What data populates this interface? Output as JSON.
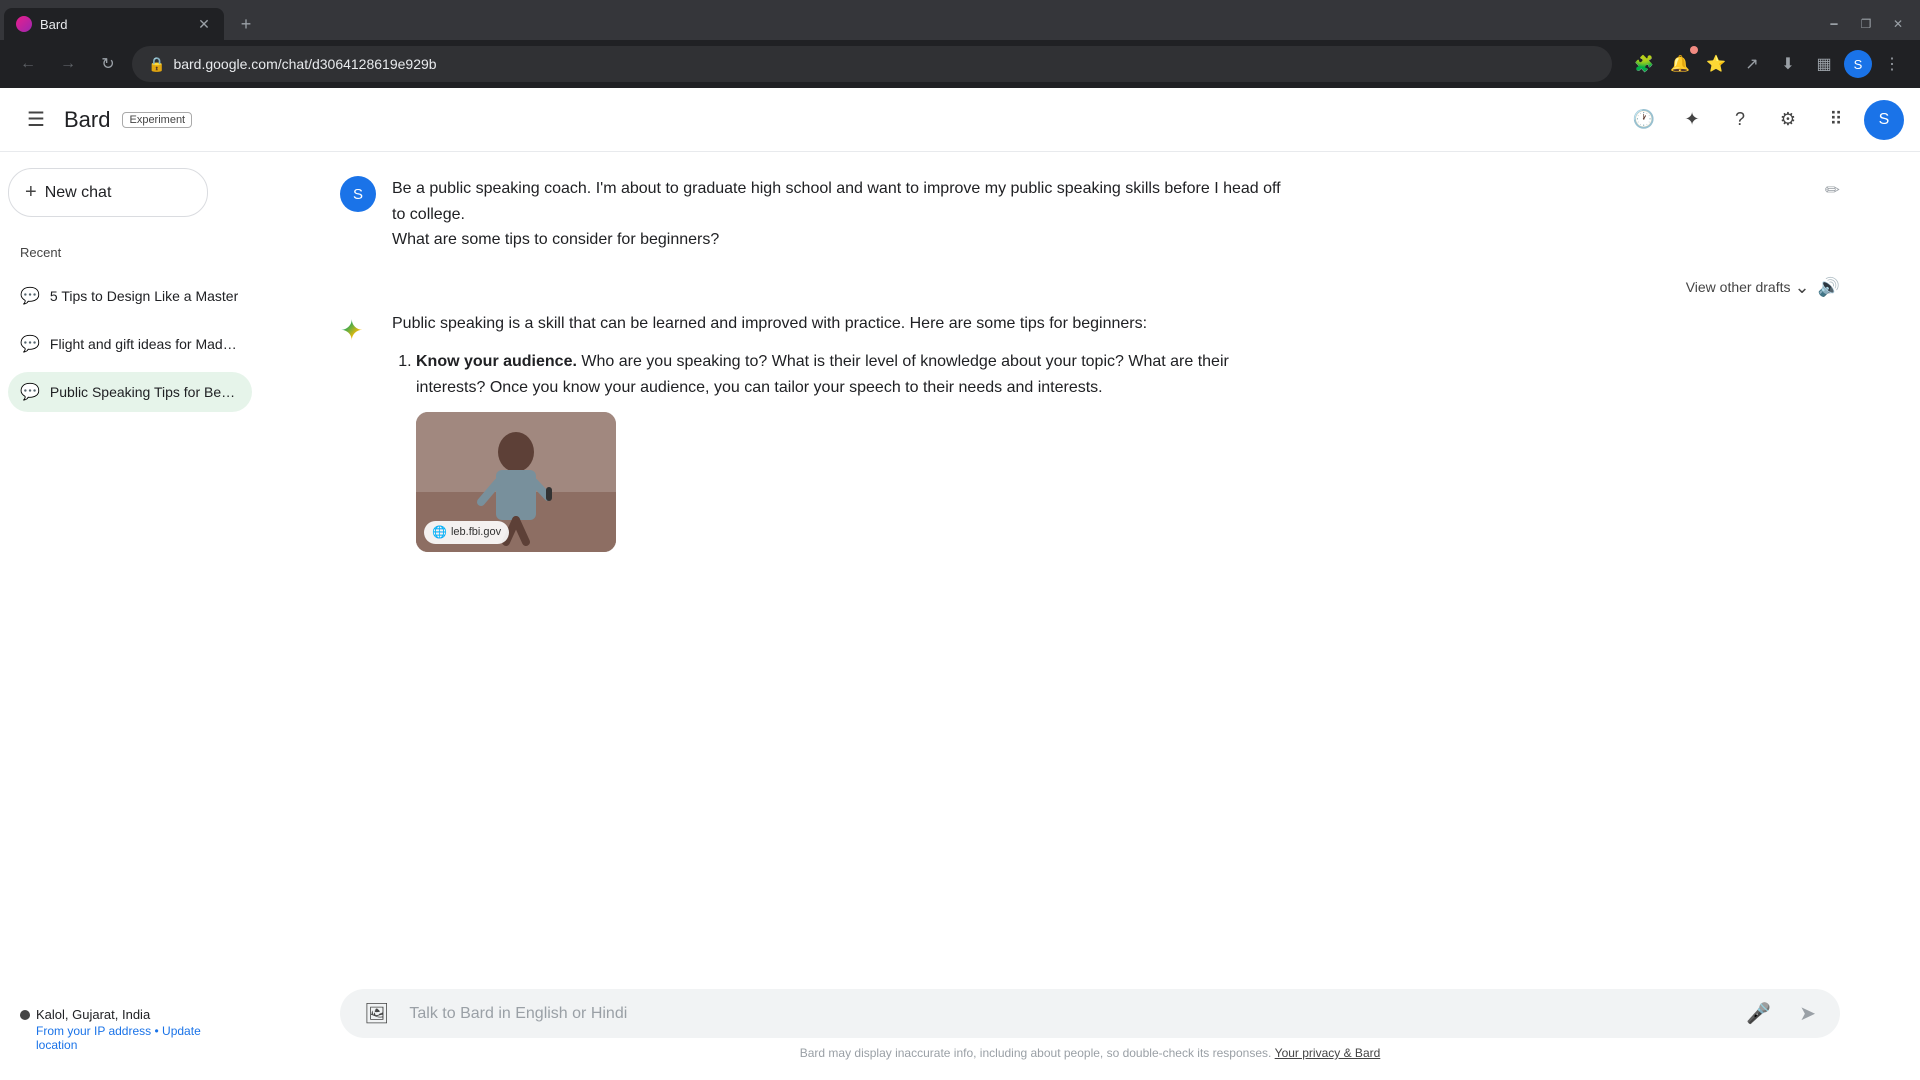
{
  "browser": {
    "tab_title": "Bard",
    "tab_favicon": "B",
    "address": "bard.google.com/chat/d3064128619e929b",
    "close_btn": "✕",
    "new_tab_btn": "+",
    "window_minimize": "—",
    "window_restore": "⧉",
    "window_close": "✕",
    "nav_back": "←",
    "nav_forward": "→",
    "nav_refresh": "↻",
    "lock_icon": "🔒"
  },
  "header": {
    "menu_icon": "☰",
    "title": "Bard",
    "experiment_label": "Experiment",
    "profile_letter": "S",
    "history_icon": "🕐",
    "star_icon": "✦",
    "help_icon": "?",
    "settings_icon": "⚙",
    "apps_icon": "⠿"
  },
  "sidebar": {
    "new_chat_label": "New chat",
    "recent_label": "Recent",
    "chat_items": [
      {
        "name": "5 Tips to Design Like a Master",
        "active": false
      },
      {
        "name": "Flight and gift ideas for Madrid t...",
        "active": false
      },
      {
        "name": "Public Speaking Tips for Begin...",
        "active": true
      }
    ],
    "location": "Kalol, Gujarat, India",
    "location_sub": "From your IP address",
    "update_location": "Update location"
  },
  "chat": {
    "user_avatar": "S",
    "user_message": "Be a public speaking coach. I'm about to graduate high school and want to improve my public speaking skills before I head off to college.\nWhat are some tips to consider for beginners?",
    "drafts_label": "View other drafts",
    "bard_intro": "Public speaking is a skill that can be learned and improved with practice. Here are some tips for beginners:",
    "tips": [
      {
        "number": 1,
        "bold": "Know your audience.",
        "text": " Who are you speaking to? What is their level of knowledge about your topic? What are their interests? Once you know your audience, you can tailor your speech to their needs and interests."
      }
    ],
    "image_source": "leb.fbi.gov"
  },
  "input": {
    "placeholder": "Talk to Bard in English or Hindi",
    "footer_note": "Bard may display inaccurate info, including about people, so double-check its responses.",
    "footer_link": "Your privacy & Bard"
  }
}
